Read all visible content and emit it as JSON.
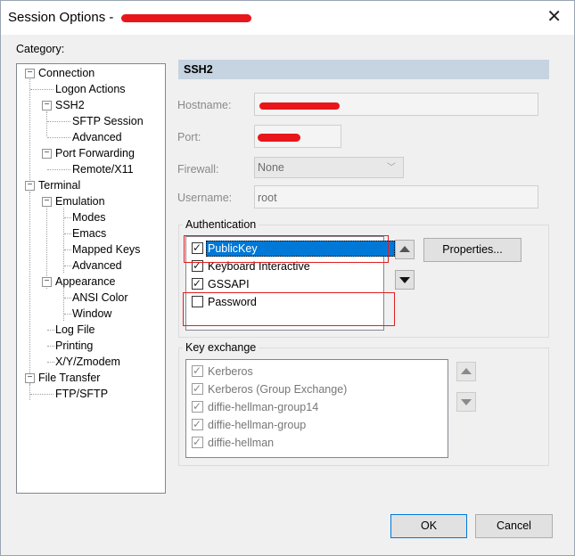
{
  "window": {
    "title": "Session Options -",
    "close_glyph": "✕"
  },
  "category_label": "Category:",
  "tree": [
    {
      "label": "Connection"
    },
    {
      "label": "Logon Actions"
    },
    {
      "label": "SSH2"
    },
    {
      "label": "SFTP Session"
    },
    {
      "label": "Advanced"
    },
    {
      "label": "Port Forwarding"
    },
    {
      "label": "Remote/X11"
    },
    {
      "label": "Terminal"
    },
    {
      "label": "Emulation"
    },
    {
      "label": "Modes"
    },
    {
      "label": "Emacs"
    },
    {
      "label": "Mapped Keys"
    },
    {
      "label": "Advanced"
    },
    {
      "label": "Appearance"
    },
    {
      "label": "ANSI Color"
    },
    {
      "label": "Window"
    },
    {
      "label": "Log File"
    },
    {
      "label": "Printing"
    },
    {
      "label": "X/Y/Zmodem"
    },
    {
      "label": "File Transfer"
    },
    {
      "label": "FTP/SFTP"
    }
  ],
  "panel": {
    "header": "SSH2",
    "hostname_label": "Hostname:",
    "port_label": "Port:",
    "firewall_label": "Firewall:",
    "firewall_value": "None",
    "username_label": "Username:",
    "username_value": "root"
  },
  "authentication": {
    "label": "Authentication",
    "items": [
      {
        "label": "PublicKey",
        "checked": true,
        "selected": true
      },
      {
        "label": "Keyboard Interactive",
        "checked": true
      },
      {
        "label": "GSSAPI",
        "checked": true
      },
      {
        "label": "Password",
        "checked": false
      }
    ],
    "properties_label": "Properties..."
  },
  "key_exchange": {
    "label": "Key exchange",
    "items": [
      {
        "label": "Kerberos",
        "checked": true
      },
      {
        "label": "Kerberos (Group Exchange)",
        "checked": true
      },
      {
        "label": "diffie-hellman-group14",
        "checked": true
      },
      {
        "label": "diffie-hellman-group",
        "checked": true
      },
      {
        "label": "diffie-hellman",
        "checked": true
      }
    ]
  },
  "buttons": {
    "ok": "OK",
    "cancel": "Cancel"
  },
  "icons": {
    "expand": "minus-box-icon",
    "up": "arrow-up-icon",
    "down": "arrow-down-icon"
  },
  "colors": {
    "selection": "#0078d7",
    "header_bg": "#c6d3e0",
    "annotation": "#e02020",
    "redaction": "#e8161b"
  }
}
